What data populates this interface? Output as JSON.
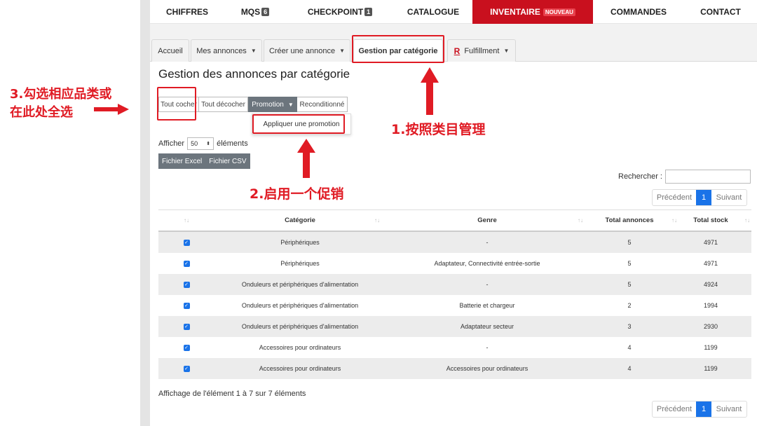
{
  "topnav": [
    {
      "label": "CHIFFRES"
    },
    {
      "label": "MQS",
      "badge": "6"
    },
    {
      "label": "CHECKPOINT",
      "badge": "1"
    },
    {
      "label": "CATALOGUE"
    },
    {
      "label": "INVENTAIRE",
      "badge": "NOUVEAU",
      "active": true
    },
    {
      "label": "COMMANDES"
    },
    {
      "label": "CONTACT"
    }
  ],
  "subtabs": {
    "home": "Accueil",
    "my_listings": "Mes annonces",
    "create_listing": "Créer une annonce",
    "by_category": "Gestion par catégorie",
    "fulfillment_logo": "R",
    "fulfillment": "Fulfillment"
  },
  "page_title": "Gestion des annonces par catégorie",
  "actions": {
    "check_all": "Tout cocher",
    "uncheck_all": "Tout décocher",
    "promotion": "Promotion",
    "refurbished": "Reconditionné",
    "apply_promotion": "Appliquer une promotion"
  },
  "show": {
    "prefix": "Afficher",
    "value": "50",
    "suffix": "éléments"
  },
  "export": {
    "excel": "Fichier Excel",
    "csv": "Fichier CSV"
  },
  "search": {
    "label": "Rechercher :"
  },
  "pager": {
    "prev": "Précédent",
    "page": "1",
    "next": "Suivant"
  },
  "table": {
    "headers": [
      "",
      "Catégorie",
      "Genre",
      "Total annonces",
      "Total stock"
    ],
    "rows": [
      {
        "cat": "Périphériques",
        "genre": "-",
        "total": "5",
        "stock": "4971"
      },
      {
        "cat": "Périphériques",
        "genre": "Adaptateur, Connectivité entrée-sortie",
        "total": "5",
        "stock": "4971"
      },
      {
        "cat": "Onduleurs et périphériques d'alimentation",
        "genre": "-",
        "total": "5",
        "stock": "4924"
      },
      {
        "cat": "Onduleurs et périphériques d'alimentation",
        "genre": "Batterie et chargeur",
        "total": "2",
        "stock": "1994"
      },
      {
        "cat": "Onduleurs et périphériques d'alimentation",
        "genre": "Adaptateur secteur",
        "total": "3",
        "stock": "2930"
      },
      {
        "cat": "Accessoires pour ordinateurs",
        "genre": "-",
        "total": "4",
        "stock": "1199"
      },
      {
        "cat": "Accessoires pour ordinateurs",
        "genre": "Accessoires pour ordinateurs",
        "total": "4",
        "stock": "1199"
      }
    ]
  },
  "footer_info": "Affichage de l'élément 1 à 7 sur 7 éléments",
  "annotations": {
    "step1": "1.按照类目管理",
    "step2": "2.启用一个促销",
    "step3_line1": "3.勾选相应品类或",
    "step3_line2": "在此处全选"
  },
  "colors": {
    "accent_red": "#c9101e",
    "annotation_red": "#e01b24",
    "primary_blue": "#1a73e8"
  }
}
